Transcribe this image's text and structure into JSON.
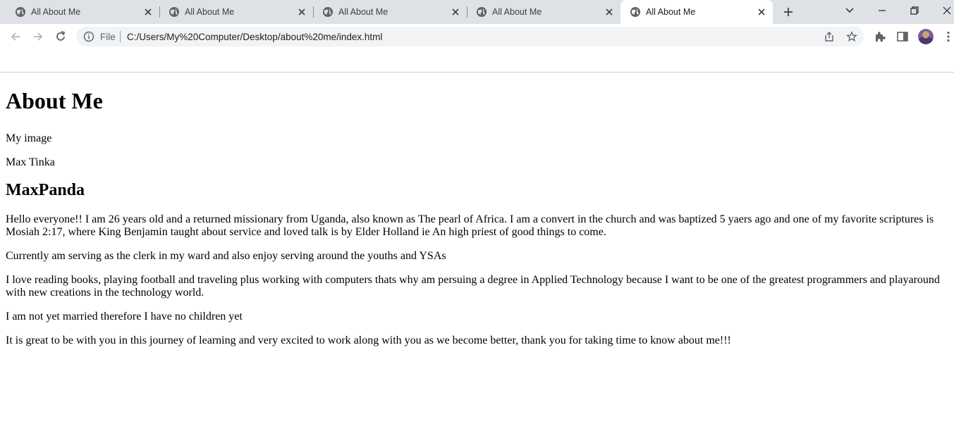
{
  "browser": {
    "tabs": [
      {
        "title": "All About Me",
        "active": false
      },
      {
        "title": "All About Me",
        "active": false
      },
      {
        "title": "All About Me",
        "active": false
      },
      {
        "title": "All About Me",
        "active": false
      },
      {
        "title": "All About Me",
        "active": true
      }
    ],
    "address": {
      "scheme_label": "File",
      "url": "C:/Users/My%20Computer/Desktop/about%20me/index.html"
    }
  },
  "page": {
    "heading": "About Me",
    "image_alt": "My image",
    "name": "Max Tinka",
    "subheading": "MaxPanda",
    "paragraphs": [
      "Hello everyone!! I am 26 years old and a returned missionary from Uganda, also known as The pearl of Africa. I am a convert in the church and was baptized 5 yaers ago and one of my favorite scriptures is Mosiah 2:17, where King Benjamin taught about service and loved talk is by Elder Holland ie An high priest of good things to come.",
      "Currently am serving as the clerk in my ward and also enjoy serving around the youths and YSAs",
      "I love reading books, playing football and traveling plus working with computers thats why am persuing a degree in Applied Technology because I want to be one of the greatest programmers and playaround with new creations in the technology world.",
      "I am not yet married therefore I have no children yet",
      "It is great to be with you in this journey of learning and very excited to work along with you as we become better, thank you for taking time to know about me!!!"
    ]
  },
  "icons": {
    "favicon": "globe-icon",
    "close": "close-icon",
    "new_tab": "plus-icon",
    "tab_search": "chevron-down-icon",
    "minimize": "minimize-icon",
    "restore": "restore-icon",
    "window_close": "close-icon",
    "back": "back-arrow-icon",
    "forward": "forward-arrow-icon",
    "reload": "reload-icon",
    "info": "info-icon",
    "share": "share-icon",
    "bookmark": "star-icon",
    "extensions": "puzzle-icon",
    "side_panel": "side-panel-icon",
    "menu": "kebab-menu-icon"
  },
  "colors": {
    "tabstrip_bg": "#dee1e6",
    "omnibox_bg": "#f1f3f4",
    "icon": "#5f6368"
  }
}
